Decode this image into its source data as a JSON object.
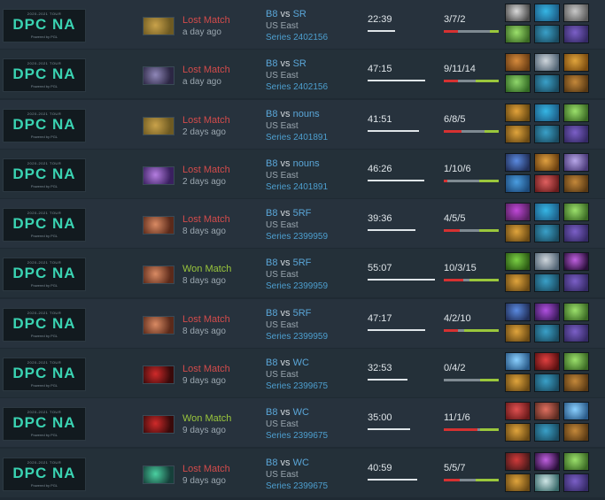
{
  "league": {
    "tour_label": "2020-2021 TOUR",
    "name": "DPC NA",
    "sub_label": "Powered by PGL"
  },
  "colors": {
    "won": "#9ac73c",
    "lost": "#d34b4b",
    "kills": "#d63131",
    "deaths": "#7f8a92",
    "assists": "#9ac73c"
  },
  "matches": [
    {
      "hero_icon": "sand-hero-icon",
      "hero_colors": [
        "#c9a24a",
        "#6e5a22"
      ],
      "result": "Lost Match",
      "won": false,
      "ago": "a day ago",
      "team": "B8",
      "vs": "vs",
      "opponent": "SR",
      "region": "US East",
      "series": "Series 2402156",
      "duration": "22:39",
      "duration_fraction": 0.39,
      "kda": "3/7/2",
      "kda_split": [
        3,
        7,
        2
      ],
      "items": [
        [
          "#d9d9d9",
          "#4c4c4c"
        ],
        [
          "#36b6e5",
          "#1d5f88"
        ],
        [
          "#c8c8c8",
          "#5c5c5c"
        ],
        [
          "#9be06b",
          "#3b6a24"
        ],
        [
          "#3aa0c8",
          "#1b4d63"
        ],
        [
          "#7b5fc7",
          "#352a66"
        ]
      ]
    },
    {
      "hero_icon": "ghost-hero-icon",
      "hero_colors": [
        "#8f87b8",
        "#2c2744"
      ],
      "result": "Lost Match",
      "won": false,
      "ago": "a day ago",
      "team": "B8",
      "vs": "vs",
      "opponent": "SR",
      "region": "US East",
      "series": "Series 2402156",
      "duration": "47:15",
      "duration_fraction": 0.81,
      "kda": "9/11/14",
      "kda_split": [
        9,
        11,
        14
      ],
      "items": [
        [
          "#d68a3c",
          "#6b3e14"
        ],
        [
          "#cfd6dc",
          "#526474"
        ],
        [
          "#e0a43c",
          "#7b4c10"
        ],
        [
          "#8fd66b",
          "#336a24"
        ],
        [
          "#3aa0c8",
          "#1b4d63"
        ],
        [
          "#c4883a",
          "#5a3a14"
        ]
      ]
    },
    {
      "hero_icon": "sand-hero-icon",
      "hero_colors": [
        "#c9a24a",
        "#6e5a22"
      ],
      "result": "Lost Match",
      "won": false,
      "ago": "2 days ago",
      "team": "B8",
      "vs": "vs",
      "opponent": "nouns",
      "region": "US East",
      "series": "Series 2401891",
      "duration": "41:51",
      "duration_fraction": 0.72,
      "kda": "6/8/5",
      "kda_split": [
        6,
        8,
        5
      ],
      "items": [
        [
          "#e2a23a",
          "#6a4a12"
        ],
        [
          "#36b6e5",
          "#1d5f88"
        ],
        [
          "#9be06b",
          "#3b6a24"
        ],
        [
          "#e0a43c",
          "#6b4a14"
        ],
        [
          "#3aa0c8",
          "#1b4d63"
        ],
        [
          "#7b5fc7",
          "#352a66"
        ]
      ]
    },
    {
      "hero_icon": "violet-hero-icon",
      "hero_colors": [
        "#b47de0",
        "#3a2060"
      ],
      "result": "Lost Match",
      "won": false,
      "ago": "2 days ago",
      "team": "B8",
      "vs": "vs",
      "opponent": "nouns",
      "region": "US East",
      "series": "Series 2401891",
      "duration": "46:26",
      "duration_fraction": 0.8,
      "kda": "1/10/6",
      "kda_split": [
        1,
        10,
        6
      ],
      "items": [
        [
          "#5a8ae0",
          "#22305a"
        ],
        [
          "#e0a040",
          "#6a4010"
        ],
        [
          "#b7a6e8",
          "#4a3a78"
        ],
        [
          "#4a9de0",
          "#1d4a7a"
        ],
        [
          "#e06060",
          "#6a1d1d"
        ],
        [
          "#c4883a",
          "#5a3a14"
        ]
      ]
    },
    {
      "hero_icon": "flesh-hero-icon",
      "hero_colors": [
        "#d98a63",
        "#5b2a1a"
      ],
      "result": "Lost Match",
      "won": false,
      "ago": "8 days ago",
      "team": "B8",
      "vs": "vs",
      "opponent": "5RF",
      "region": "US East",
      "series": "Series 2399959",
      "duration": "39:36",
      "duration_fraction": 0.68,
      "kda": "4/5/5",
      "kda_split": [
        4,
        5,
        5
      ],
      "items": [
        [
          "#c048d8",
          "#55205f"
        ],
        [
          "#36b6e5",
          "#1d5f88"
        ],
        [
          "#9be06b",
          "#3b6a24"
        ],
        [
          "#e0a43c",
          "#6b4a14"
        ],
        [
          "#3aa0c8",
          "#1b4d63"
        ],
        [
          "#7b5fc7",
          "#352a66"
        ]
      ]
    },
    {
      "hero_icon": "flesh-hero-icon",
      "hero_colors": [
        "#d98a63",
        "#5b2a1a"
      ],
      "result": "Won Match",
      "won": true,
      "ago": "8 days ago",
      "team": "B8",
      "vs": "vs",
      "opponent": "5RF",
      "region": "US East",
      "series": "Series 2399959",
      "duration": "55:07",
      "duration_fraction": 0.95,
      "kda": "10/3/15",
      "kda_split": [
        10,
        3,
        15
      ],
      "items": [
        [
          "#7ad044",
          "#2c5a14"
        ],
        [
          "#cfd6dc",
          "#526474"
        ],
        [
          "#c060e0",
          "#2a0f3a"
        ],
        [
          "#e0a43c",
          "#6b4a14"
        ],
        [
          "#3aa0c8",
          "#1b4d63"
        ],
        [
          "#7b5fc7",
          "#352a66"
        ]
      ]
    },
    {
      "hero_icon": "flesh-hero-icon",
      "hero_colors": [
        "#d98a63",
        "#5b2a1a"
      ],
      "result": "Lost Match",
      "won": false,
      "ago": "8 days ago",
      "team": "B8",
      "vs": "vs",
      "opponent": "5RF",
      "region": "US East",
      "series": "Series 2399959",
      "duration": "47:17",
      "duration_fraction": 0.81,
      "kda": "4/2/10",
      "kda_split": [
        4,
        2,
        10
      ],
      "items": [
        [
          "#5a8ae0",
          "#22305a"
        ],
        [
          "#b050e0",
          "#3a1a5a"
        ],
        [
          "#9be06b",
          "#3b6a24"
        ],
        [
          "#e0a43c",
          "#6b4a14"
        ],
        [
          "#3aa0c8",
          "#1b4d63"
        ],
        [
          "#7b5fc7",
          "#352a66"
        ]
      ]
    },
    {
      "hero_icon": "crimson-hero-icon",
      "hero_colors": [
        "#d02a2a",
        "#3a0a0a"
      ],
      "result": "Lost Match",
      "won": false,
      "ago": "9 days ago",
      "team": "B8",
      "vs": "vs",
      "opponent": "WC",
      "region": "US East",
      "series": "Series 2399675",
      "duration": "32:53",
      "duration_fraction": 0.56,
      "kda": "0/4/2",
      "kda_split": [
        0,
        4,
        2
      ],
      "items": [
        [
          "#8ad0ff",
          "#2a5a88"
        ],
        [
          "#e04040",
          "#5a1010"
        ],
        [
          "#9be06b",
          "#3b6a24"
        ],
        [
          "#e0a43c",
          "#6b4a14"
        ],
        [
          "#3aa0c8",
          "#1b4d63"
        ],
        [
          "#c4883a",
          "#5a3a14"
        ]
      ]
    },
    {
      "hero_icon": "crimson-hero-icon",
      "hero_colors": [
        "#d02a2a",
        "#3a0a0a"
      ],
      "result": "Won Match",
      "won": true,
      "ago": "9 days ago",
      "team": "B8",
      "vs": "vs",
      "opponent": "WC",
      "region": "US East",
      "series": "Series 2399675",
      "duration": "35:00",
      "duration_fraction": 0.6,
      "kda": "11/1/6",
      "kda_split": [
        11,
        1,
        6
      ],
      "items": [
        [
          "#e05050",
          "#6a1a1a"
        ],
        [
          "#e07060",
          "#5a2a20"
        ],
        [
          "#8ad0ff",
          "#2a5a88"
        ],
        [
          "#e0a43c",
          "#6b4a14"
        ],
        [
          "#3aa0c8",
          "#1b4d63"
        ],
        [
          "#c4883a",
          "#5a3a14"
        ]
      ]
    },
    {
      "hero_icon": "teal-hero-icon",
      "hero_colors": [
        "#4ad0a0",
        "#16403a"
      ],
      "result": "Lost Match",
      "won": false,
      "ago": "9 days ago",
      "team": "B8",
      "vs": "vs",
      "opponent": "WC",
      "region": "US East",
      "series": "Series 2399675",
      "duration": "40:59",
      "duration_fraction": 0.7,
      "kda": "5/5/7",
      "kda_split": [
        5,
        5,
        7
      ],
      "items": [
        [
          "#d03a3a",
          "#4a1a1a"
        ],
        [
          "#c060e0",
          "#2a0f3a"
        ],
        [
          "#9be06b",
          "#3b6a24"
        ],
        [
          "#e0a43c",
          "#6b4a14"
        ],
        [
          "#cfe6e6",
          "#3a6a6a"
        ],
        [
          "#7b5fc7",
          "#352a66"
        ]
      ]
    }
  ]
}
